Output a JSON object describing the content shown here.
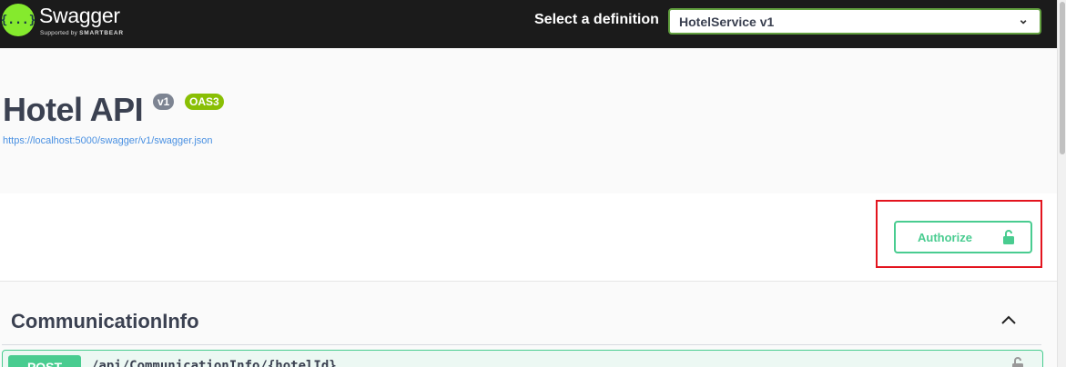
{
  "topbar": {
    "logo_glyph": "{...}",
    "logo_title": "Swagger",
    "logo_supported": "Supported by",
    "logo_brand": "SMARTBEAR",
    "definition_label": "Select a definition",
    "definition_selected": "HotelService v1"
  },
  "info": {
    "title": "Hotel API",
    "version_badge": "v1",
    "oas_badge": "OAS3",
    "spec_url": "https://localhost:5000/swagger/v1/swagger.json"
  },
  "auth": {
    "button_label": "Authorize"
  },
  "section": {
    "title": "CommunicationInfo",
    "operation": {
      "method": "POST",
      "path": "/api/CommunicationInfo/{hotelId}"
    }
  },
  "colors": {
    "topbar_bg": "#1b1b1b",
    "accent_green": "#49cc90",
    "highlight_red": "#e3141e",
    "oas_badge": "#89bf04"
  }
}
